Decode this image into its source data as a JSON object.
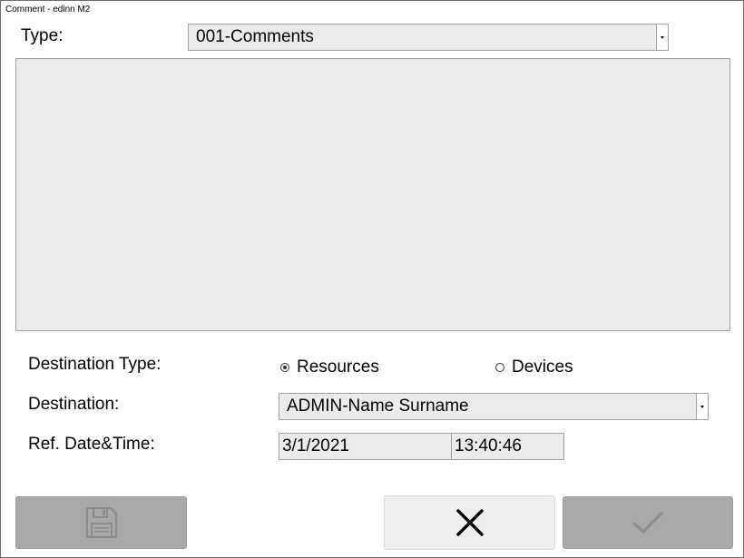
{
  "window": {
    "title": "Comment - edinn M2"
  },
  "type_row": {
    "label": "Type:",
    "selected": "001-Comments"
  },
  "comment_box": {
    "value": ""
  },
  "destination_type": {
    "label": "Destination Type:",
    "options": [
      {
        "label": "Resources",
        "selected": true
      },
      {
        "label": "Devices",
        "selected": false
      }
    ]
  },
  "destination": {
    "label": "Destination:",
    "selected": "ADMIN-Name Surname"
  },
  "ref_datetime": {
    "label": "Ref. Date&Time:",
    "date": "3/1/2021",
    "time": "13:40:46"
  },
  "icons": {
    "save": "floppy-disk-icon",
    "cancel": "close-x-icon",
    "confirm": "checkmark-icon"
  }
}
